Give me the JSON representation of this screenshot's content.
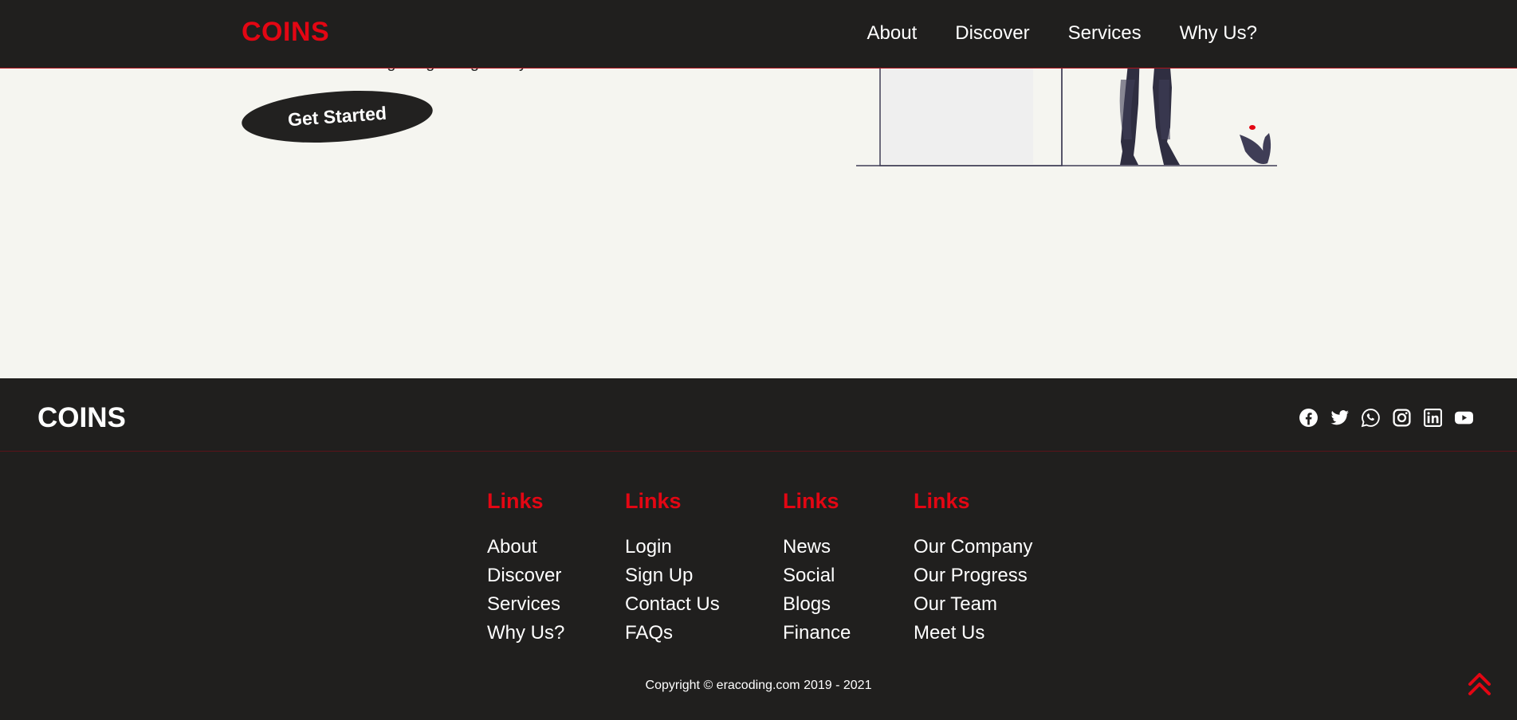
{
  "header": {
    "logo": "COINS",
    "nav": [
      "About",
      "Discover",
      "Services",
      "Why Us?"
    ]
  },
  "hero": {
    "text_partial": "transactions without getting charged any fees",
    "cta_label": "Get Started"
  },
  "footer": {
    "logo": "COINS",
    "socials": [
      "facebook-icon",
      "twitter-icon",
      "whatsapp-icon",
      "instagram-icon",
      "linkedin-icon",
      "youtube-icon"
    ],
    "columns": [
      {
        "title": "Links",
        "links": [
          "About",
          "Discover",
          "Services",
          "Why Us?"
        ]
      },
      {
        "title": "Links",
        "links": [
          "Login",
          "Sign Up",
          "Contact Us",
          "FAQs"
        ]
      },
      {
        "title": "Links",
        "links": [
          "News",
          "Social",
          "Blogs",
          "Finance"
        ]
      },
      {
        "title": "Links",
        "links": [
          "Our Company",
          "Our Progress",
          "Our Team",
          "Meet Us"
        ]
      }
    ],
    "copyright": "Copyright © eracoding.com 2019 - 2021"
  },
  "colors": {
    "accent": "#e30613",
    "dark": "#201f1e",
    "background": "#f5f5f0"
  }
}
